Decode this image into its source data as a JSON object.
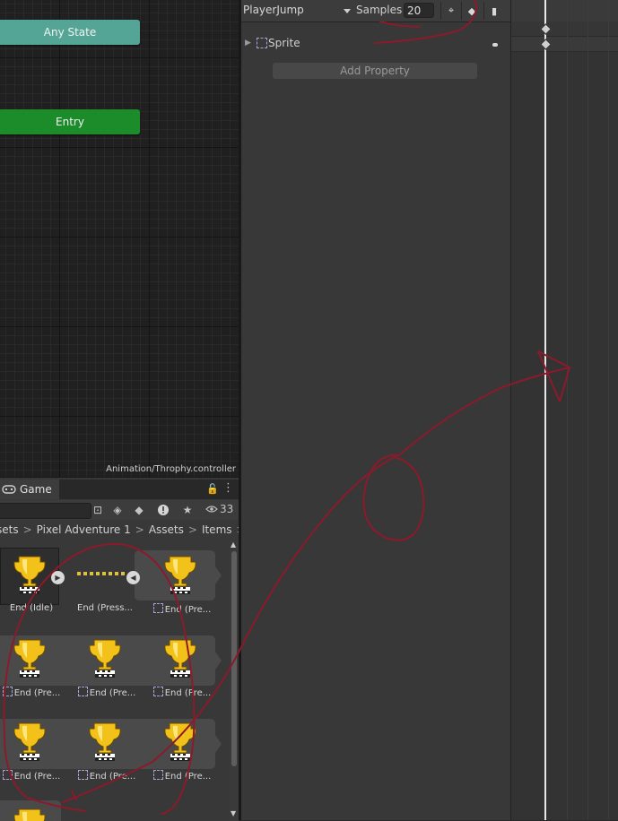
{
  "animator": {
    "nodes": [
      {
        "label": "Any State",
        "color": "#55a596"
      },
      {
        "label": "Entry",
        "color": "#1c8b2a"
      }
    ],
    "controller_path": "Animation/Throphy.controller"
  },
  "project": {
    "tab_label": "Game",
    "hidden_count": "33",
    "breadcrumb": [
      "sets",
      "Pixel Adventure 1",
      "Assets",
      "Items"
    ],
    "rows": [
      [
        "End (Idle)",
        "End (Press...",
        "End (Pre..."
      ],
      [
        "End (Pre...",
        "End (Pre...",
        "End (Pre..."
      ],
      [
        "End (Pre...",
        "End (Pre...",
        "End (Pre..."
      ]
    ]
  },
  "animation": {
    "clip_name": "PlayerJump",
    "samples_label": "Samples",
    "samples_value": "20",
    "property_label": "Sprite",
    "add_property_label": "Add Property"
  },
  "colors": {
    "annotation": "#8b1a2b",
    "trophy": "#f2c21a"
  }
}
